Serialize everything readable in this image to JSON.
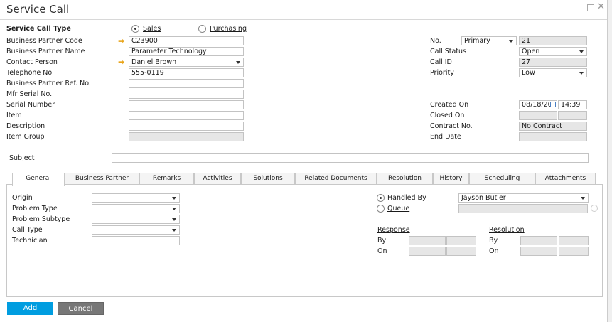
{
  "window": {
    "title": "Service Call"
  },
  "header": {
    "service_call_type_label": "Service Call Type",
    "type_options": [
      {
        "label": "Sales",
        "selected": true
      },
      {
        "label": "Purchasing",
        "selected": false
      }
    ],
    "left_fields": [
      {
        "label": "Business Partner Code",
        "value": "C23900",
        "arrow": true
      },
      {
        "label": "Business Partner Name",
        "value": "Parameter Technology"
      },
      {
        "label": "Contact Person",
        "value": "Daniel Brown",
        "arrow": true,
        "dropdown": true
      },
      {
        "label": "Telephone No.",
        "value": "555-0119"
      },
      {
        "label": "Business Partner Ref. No.",
        "value": ""
      },
      {
        "label": "Mfr Serial No.",
        "value": ""
      },
      {
        "label": "Serial Number",
        "value": ""
      },
      {
        "label": "Item",
        "value": ""
      },
      {
        "label": "Description",
        "value": ""
      },
      {
        "label": "Item Group",
        "value": "",
        "disabled": true
      }
    ],
    "no_label": "No.",
    "series": "Primary",
    "number": "21",
    "call_status_label": "Call Status",
    "call_status": "Open",
    "call_id_label": "Call ID",
    "call_id": "27",
    "priority_label": "Priority",
    "priority": "Low",
    "created_on_label": "Created On",
    "created_date": "08/18/20",
    "created_time": "14:39",
    "closed_on_label": "Closed On",
    "contract_label": "Contract No.",
    "contract": "No Contract",
    "end_date_label": "End Date",
    "subject_label": "Subject",
    "subject": ""
  },
  "tabs": [
    "General",
    "Business Partner",
    "Remarks",
    "Activities",
    "Solutions",
    "Related Documents",
    "Resolution",
    "History",
    "Scheduling",
    "Attachments"
  ],
  "active_tab": "General",
  "general": {
    "fields": [
      "Origin",
      "Problem Type",
      "Problem Subtype",
      "Call Type",
      "Technician"
    ],
    "handled_by_label": "Handled By",
    "handled_by": "Jayson Butler",
    "queue_label": "Queue",
    "response_label": "Response",
    "resolution_label": "Resolution",
    "by_label": "By",
    "on_label": "On"
  },
  "buttons": {
    "add": "Add",
    "cancel": "Cancel"
  },
  "colors": {
    "add": "#009de0",
    "cancel": "#777777",
    "arrow": "#e8a317"
  }
}
